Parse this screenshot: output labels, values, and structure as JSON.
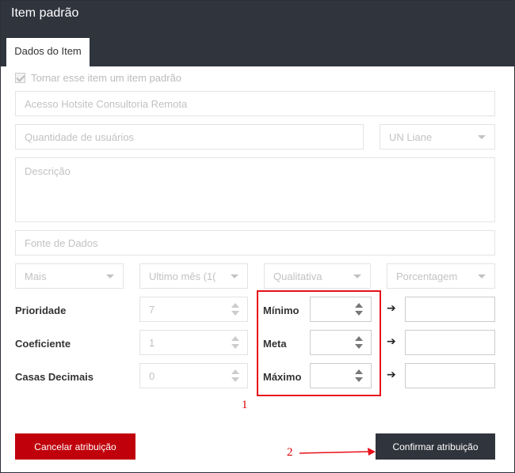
{
  "window": {
    "title": "Item padrão"
  },
  "tabs": [
    {
      "label": "Dados do Item"
    }
  ],
  "form": {
    "default_checkbox_label": "Tornar esse item um item padrão",
    "name_value": "Acesso Hotsite Consultoria Remota",
    "users_placeholder": "Quantidade de usuários",
    "owner_select": "UN Liane",
    "description_placeholder": "Descrição",
    "source_placeholder": "Fonte de Dados",
    "direction_select": "Mais",
    "period_select": "Ultimo mês (1(",
    "type_select": "Qualitativa",
    "unit_select": "Porcentagem",
    "priority_label": "Prioridade",
    "priority_value": "7",
    "coef_label": "Coeficiente",
    "coef_value": "1",
    "decimals_label": "Casas Decimais",
    "decimals_value": "0",
    "min_label": "Mínimo",
    "meta_label": "Meta",
    "max_label": "Máximo",
    "arrow_glyph": "➔"
  },
  "buttons": {
    "cancel": "Cancelar atribuição",
    "confirm": "Confirmar atribuição"
  },
  "annotations": {
    "one": "1",
    "two": "2"
  },
  "colors": {
    "header": "#30343d",
    "cancel": "#c0000b",
    "annotation": "#e8101a"
  }
}
